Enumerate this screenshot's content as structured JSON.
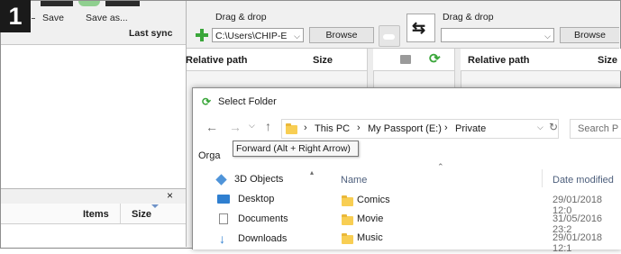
{
  "step_badge": "1",
  "left_panel": {
    "toolbar": {
      "save_label": "Save",
      "save_as_label": "Save as...",
      "last_sync_label": "Last sync"
    },
    "bottom_close": "×",
    "bottom_columns": {
      "items": "Items",
      "size": "Size"
    }
  },
  "left_folder": {
    "drag_drop_label": "Drag & drop",
    "path_value": "C:\\Users\\CHIP-E",
    "browse_label": "Browse",
    "col_relative_path": "Relative path",
    "col_size": "Size"
  },
  "right_folder": {
    "drag_drop_label": "Drag & drop",
    "path_value": "",
    "browse_label": "Browse",
    "col_relative_path": "Relative path",
    "col_size": "Size"
  },
  "dialog": {
    "title": "Select Folder",
    "breadcrumb": [
      "This PC",
      "My Passport (E:)",
      "Private"
    ],
    "search_placeholder": "Search P",
    "organise_label": "Orga",
    "tooltip": "Forward (Alt + Right Arrow)",
    "nav_items": [
      {
        "label": "3D Objects",
        "icon": "cube-icon"
      },
      {
        "label": "Desktop",
        "icon": "desktop-icon"
      },
      {
        "label": "Documents",
        "icon": "documents-icon"
      },
      {
        "label": "Downloads",
        "icon": "download-arrow-icon"
      }
    ],
    "col_name": "Name",
    "col_date": "Date modified",
    "files": [
      {
        "name": "Comics",
        "date": "29/01/2018 12:0"
      },
      {
        "name": "Movie",
        "date": "31/05/2016 23:2"
      },
      {
        "name": "Music",
        "date": "29/01/2018 12:1"
      }
    ]
  },
  "colors": {
    "accent_green": "#3aa63a",
    "folder_yellow": "#f8ce53",
    "dialog_blue": "#1e64c8"
  }
}
